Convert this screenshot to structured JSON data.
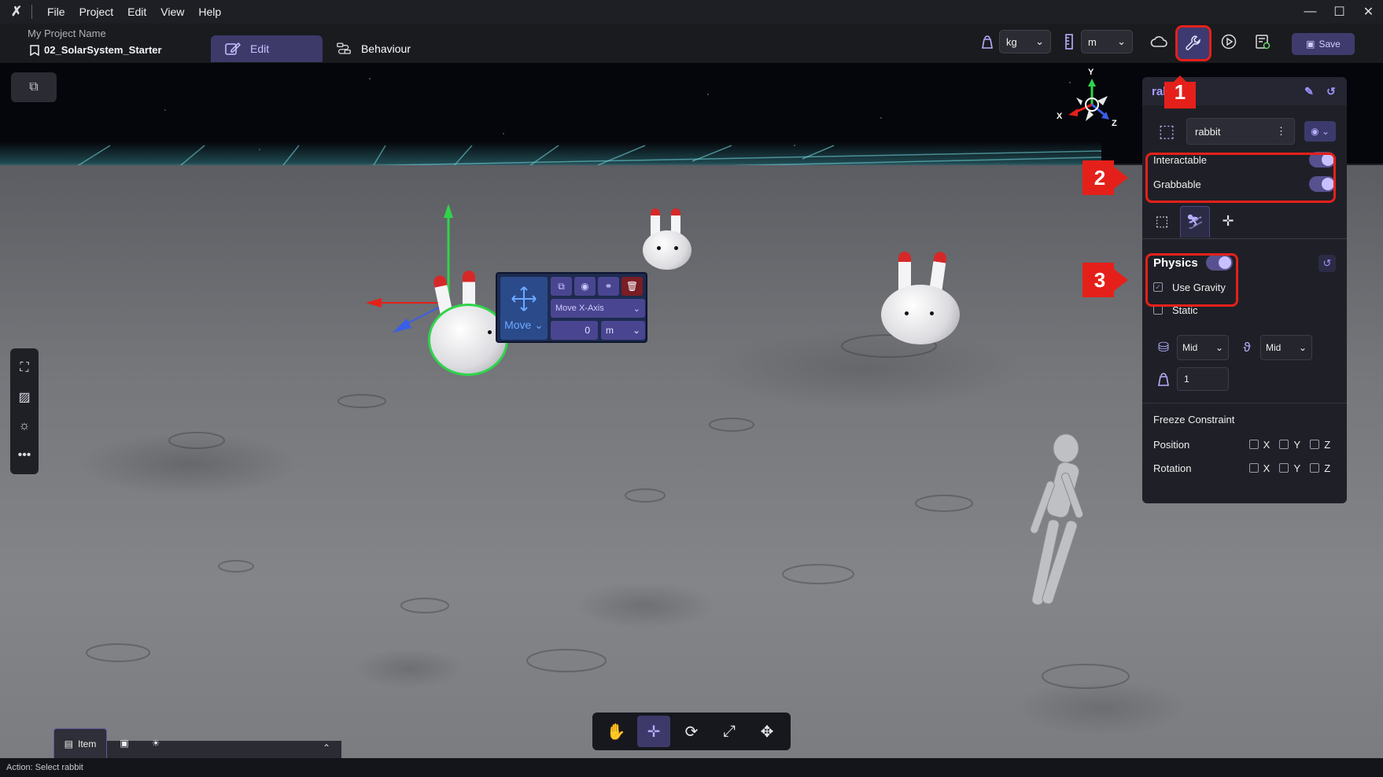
{
  "window": {
    "menu": [
      "File",
      "Project",
      "Edit",
      "View",
      "Help"
    ],
    "controls": [
      "—",
      "☐",
      "✕"
    ]
  },
  "toolbar": {
    "project_name": "My Project Name",
    "scene_name": "02_SolarSystem_Starter",
    "tab_edit": "Edit",
    "tab_behaviour": "Behaviour",
    "mass_unit": "kg",
    "length_unit": "m",
    "save_label": "Save"
  },
  "gizmo": {
    "mode_label": "Move",
    "axis_label": "Move X-Axis",
    "value": "0",
    "unit": "m"
  },
  "orientation": {
    "x": "X",
    "y": "Y",
    "z": "Z"
  },
  "panel": {
    "title": "rabbit",
    "object_name": "rabbit",
    "interactable_label": "Interactable",
    "grabbable_label": "Grabbable",
    "physics_label": "Physics",
    "use_gravity_label": "Use Gravity",
    "static_label": "Static",
    "collision_select": "Mid",
    "friction_select": "Mid",
    "mass_value": "1",
    "freeze_title": "Freeze Constraint",
    "position_label": "Position",
    "rotation_label": "Rotation",
    "axes": [
      "X",
      "Y",
      "Z"
    ]
  },
  "bottom_tabs": {
    "item_label": "Item"
  },
  "status": {
    "text": "Action: Select rabbit"
  },
  "annotations": {
    "n1": "1",
    "n2": "2",
    "n3": "3"
  },
  "colors": {
    "accent": "#3d3a6a",
    "highlight": "#e5201a",
    "toggle_knob": "#c8c0ff"
  }
}
